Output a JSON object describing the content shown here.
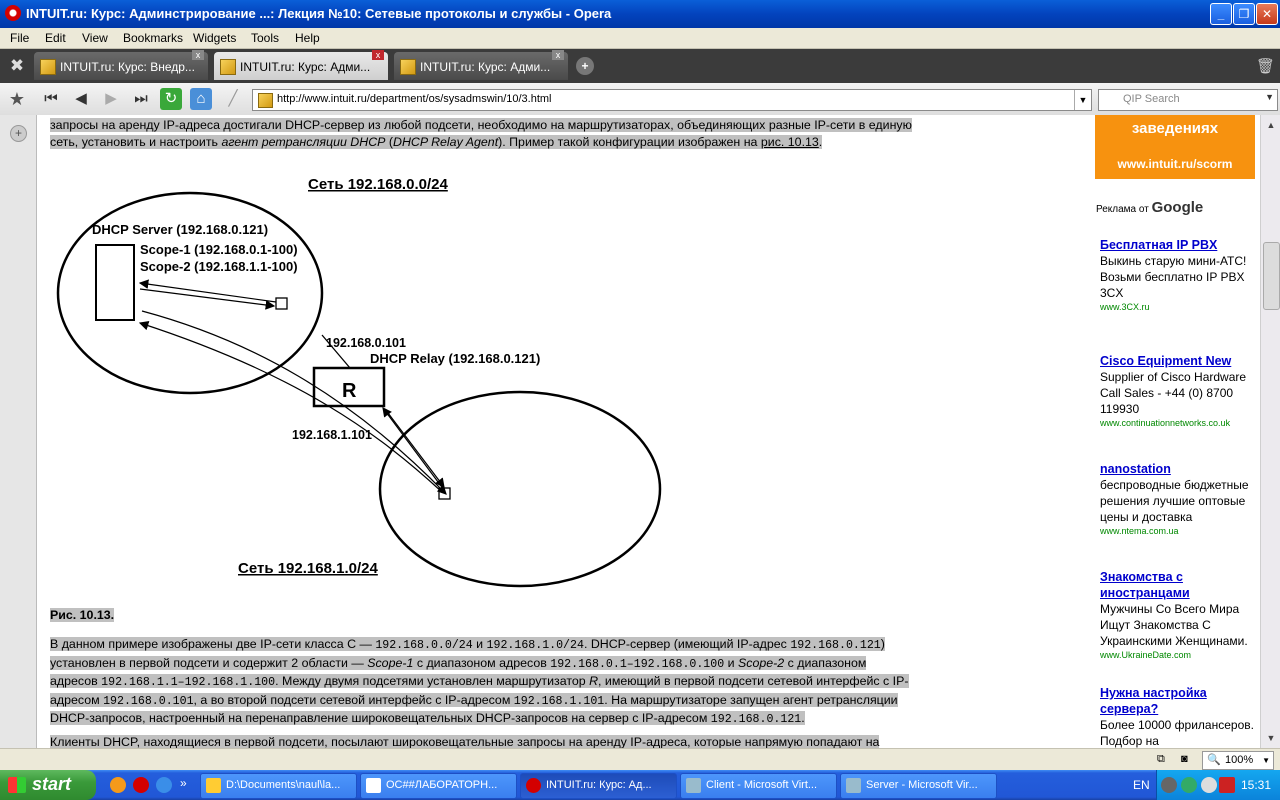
{
  "window": {
    "title": "INTUIT.ru: Курс: Админстрирование ...: Лекция №10: Сетевые протоколы и службы - Opera",
    "minimize": "_",
    "maximize": "❐",
    "close": "✕"
  },
  "menu": [
    "File",
    "Edit",
    "View",
    "Bookmarks",
    "Widgets",
    "Tools",
    "Help"
  ],
  "tabs": [
    {
      "label": "INTUIT.ru: Курс: Внедр..."
    },
    {
      "label": "INTUIT.ru: Курс: Адми..."
    },
    {
      "label": "INTUIT.ru: Курс: Адми..."
    }
  ],
  "address": {
    "url": "http://www.intuit.ru/department/os/sysadmswin/10/3.html",
    "search_placeholder": "QIP Search"
  },
  "article": {
    "intro_line1": "запросы на аренду IP-адреса достигали DHCP-сервер из любой подсети, необходимо на маршрутизаторах, объединяющих разные IP-сети в единую",
    "intro_line2_a": "сеть, установить и настроить ",
    "intro_line2_em1": "агент ретрансляции DHCP",
    "intro_line2_b": " (",
    "intro_line2_em2": "DHCP Relay Agent",
    "intro_line2_c": "). Пример такой конфигурации изображен на ",
    "intro_line2_link": "рис. 10.13",
    "intro_line2_d": ".",
    "figure_caption": "Рис. 10.13.",
    "p2": {
      "a": "В данном примере изображены две IP-сети класса С — ",
      "m1": "192.168.0.0/24",
      "b": " и ",
      "m2": "192.168.1.0/24",
      "c": ". DHCP-сервер (имеющий IP-адрес ",
      "m3": "192.168.0.121",
      "d": ")",
      "e": "установлен в первой подсети и содержит 2 области — ",
      "em1": "Scope-1",
      "f": " с диапазоном адресов ",
      "m4": "192.168.0.1–192.168.0.100",
      "g": " и ",
      "em2": "Scope-2",
      "h": " с диапазоном",
      "i": "адресов ",
      "m5": "192.168.1.1–192.168.1.100",
      "j": ". Между двумя подсетями установлен маршрутизатор ",
      "em3": "R",
      "k": ", имеющий в первой подсети сетевой интерфейс с IP-",
      "l": "адресом ",
      "m6": "192.168.0.101",
      "m": ", а во второй подсети сетевой интерфейс с IP-адресом ",
      "m7": "192.168.1.101",
      "n": ". На маршрутизаторе запущен агент ретрансляции",
      "o": "DHCP-запросов, настроенный на перенаправление широковещательных DHCP-запросов на сервер с IP-адресом ",
      "m8": "192.168.0.121",
      "p": "."
    },
    "p3": "Клиенты DHCP, находящиеся в первой подсети, посылают широковещательные запросы на аренду IP-адреса, которые напрямую попадают на"
  },
  "diagram": {
    "net0": "Сеть 192.168.0.0/24",
    "net1": "Сеть 192.168.1.0/24",
    "server": "DHCP Server (192.168.0.121)",
    "scope1": "Scope-1 (192.168.0.1-100)",
    "scope2": "Scope-2 (192.168.1.1-100)",
    "relay": "DHCP Relay (192.168.0.121)",
    "router": "R",
    "if0": "192.168.0.101",
    "if1": "192.168.1.101"
  },
  "sidebar": {
    "banner_line1": "заведениях",
    "banner_line2": "www.intuit.ru/scorm",
    "ads_label": "Реклама от",
    "ads_brand": "Google",
    "ads": [
      {
        "title": "Бесплатная IP PBX",
        "text": "Выкинь старую мини-АТС! Возьми бесплатно IP PBX 3CX",
        "url": "www.3CX.ru"
      },
      {
        "title": "Cisco Equipment New",
        "text": "Supplier of Cisco Hardware Call Sales - +44 (0) 8700 119930",
        "url": "www.continuationnetworks.co.uk"
      },
      {
        "title": "nanostation",
        "text": "беспроводные бюджетные решения лучшие оптовые цены и доставка",
        "url": "www.ntema.com.ua"
      },
      {
        "title": "Знакомства с иностранцами",
        "text": "Мужчины Со Всего Мира Ищут Знакомства С Украинскими Женщинами.",
        "url": "www.UkraineDate.com"
      },
      {
        "title": "Нужна настройка сервера?",
        "text": "Более 10000 фрилансеров. Подбор на",
        "url": ""
      }
    ]
  },
  "status": {
    "zoom": "100%"
  },
  "taskbar": {
    "start": "start",
    "tasks": [
      {
        "label": "D:\\Documents\\naul\\la..."
      },
      {
        "label": "ОС##ЛАБОРАТОРН..."
      },
      {
        "label": "INTUIT.ru: Курс: Ад..."
      },
      {
        "label": "Client - Microsoft Virt..."
      },
      {
        "label": "Server - Microsoft Vir..."
      }
    ],
    "lang": "EN",
    "clock": "15:31"
  }
}
